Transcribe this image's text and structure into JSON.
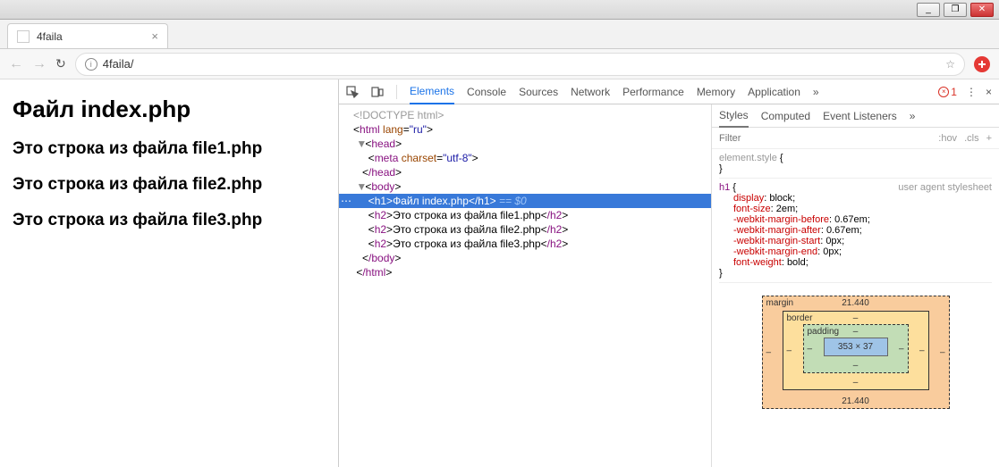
{
  "window": {
    "min": "_",
    "max": "❐",
    "close": "✕"
  },
  "tab": {
    "title": "4faila",
    "close": "×"
  },
  "address": {
    "back": "←",
    "fwd": "→",
    "reload": "↻",
    "info": "i",
    "url": "4faila/",
    "star": "☆"
  },
  "page": {
    "h1": "Файл index.php",
    "lines": [
      "Это строка из файла file1.php",
      "Это строка из файла file2.php",
      "Это строка из файла file3.php"
    ]
  },
  "devtools": {
    "tabs": [
      "Elements",
      "Console",
      "Sources",
      "Network",
      "Performance",
      "Memory",
      "Application"
    ],
    "activeTab": 0,
    "more": "»",
    "errCount": "1",
    "menu": "⋮",
    "close": "×",
    "dom": {
      "doctype": "<!DOCTYPE html>",
      "htmlOpen": "html",
      "langAttr": "lang",
      "langVal": "\"ru\"",
      "headOpen": "head",
      "metaTag": "meta",
      "charsetAttr": "charset",
      "charsetVal": "\"utf-8\"",
      "headClose": "/head",
      "bodyOpen": "body",
      "h1tag": "h1",
      "h1text": "Файл index.php",
      "h1close": "/h1",
      "eq": " == $0",
      "h2tag": "h2",
      "h2texts": [
        "Это строка из файла file1.php",
        "Это строка из файла file2.php",
        "Это строка из файла file3.php"
      ],
      "h2close": "/h2",
      "bodyClose": "/body",
      "htmlClose": "/html"
    },
    "styles": {
      "tabs": [
        "Styles",
        "Computed",
        "Event Listeners"
      ],
      "activeTab": 0,
      "more": "»",
      "filterPlaceholder": "Filter",
      "hov": ":hov",
      "cls": ".cls",
      "plus": "+",
      "rules": [
        {
          "selector": "element.style",
          "origin": "",
          "props": []
        },
        {
          "selector": "h1",
          "origin": "user agent stylesheet",
          "props": [
            {
              "n": "display",
              "v": "block"
            },
            {
              "n": "font-size",
              "v": "2em"
            },
            {
              "n": "-webkit-margin-before",
              "v": "0.67em"
            },
            {
              "n": "-webkit-margin-after",
              "v": "0.67em"
            },
            {
              "n": "-webkit-margin-start",
              "v": "0px"
            },
            {
              "n": "-webkit-margin-end",
              "v": "0px"
            },
            {
              "n": "font-weight",
              "v": "bold"
            }
          ]
        }
      ],
      "box": {
        "marginLabel": "margin",
        "marginTop": "21.440",
        "marginBot": "21.440",
        "borderLabel": "border",
        "dash": "–",
        "paddingLabel": "padding",
        "content": "353 × 37"
      }
    }
  }
}
